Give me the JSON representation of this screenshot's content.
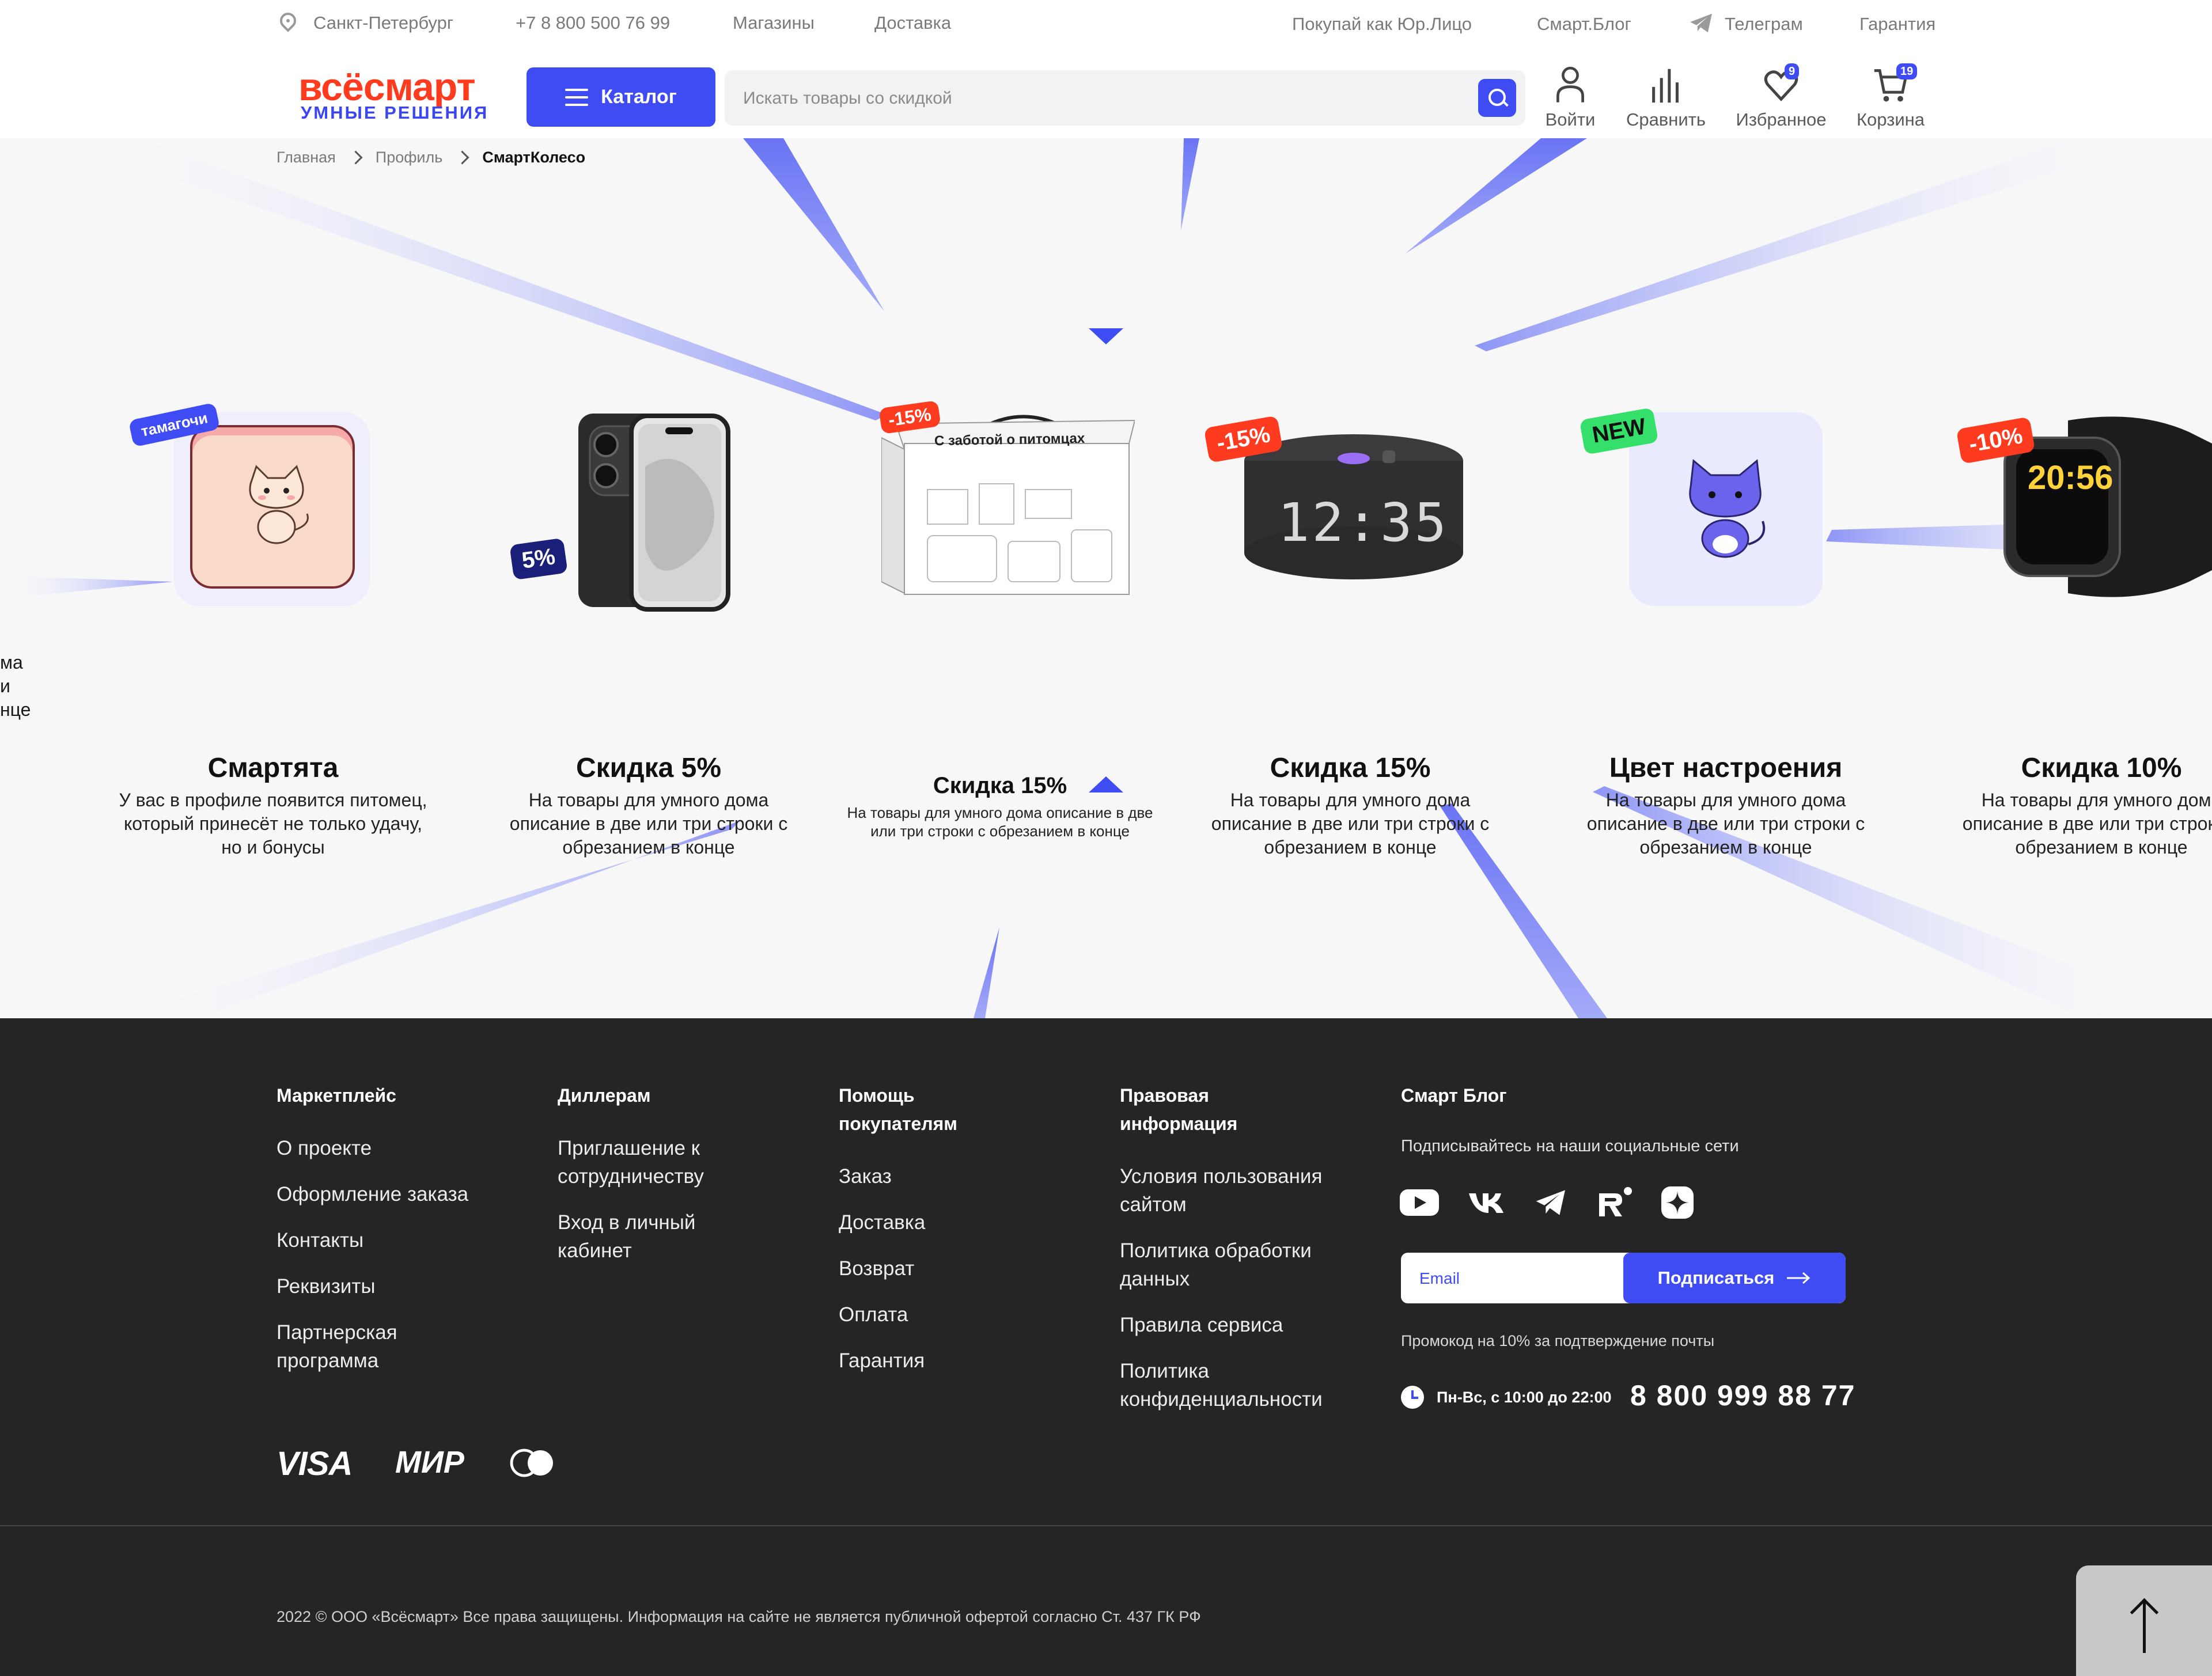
{
  "topbar": {
    "city": "Санкт-Петербург",
    "phone": "+7 8 800 500 76 99",
    "stores": "Магазины",
    "delivery": "Доставка",
    "legal_entity": "Покупай как Юр.Лицо",
    "blog": "Смарт.Блог",
    "telegram": "Телеграм",
    "warranty": "Гарантия"
  },
  "header": {
    "logo_top": "всёсмарт",
    "logo_bottom": "УМНЫЕ РЕШЕНИЯ",
    "catalog_label": "Каталог",
    "search_placeholder": "Искать товары со скидкой",
    "login_label": "Войти",
    "compare_label": "Сравнить",
    "favorites_label": "Избранное",
    "favorites_count": "9",
    "cart_label": "Корзина",
    "cart_count": "19"
  },
  "breadcrumb": {
    "items": [
      "Главная",
      "Профиль"
    ],
    "current": "СмартКолесо"
  },
  "wheel": {
    "left_partial": {
      "desc": [
        "ма",
        "и",
        "нце"
      ]
    },
    "cards": [
      {
        "tag": "тамагочи",
        "title": "Смартята",
        "desc": "У вас в профиле появится питомец, который принесёт не только удачу, но и бонусы"
      },
      {
        "tag": "5%",
        "title": "Скидка 5%",
        "desc": "На товары для умного дома описание в две или три строки с обрезанием в конце"
      },
      {
        "tag": "-15%",
        "title": "Скидка 15%",
        "desc": "На товары для умного дома описание в две или три строки с обрезанием в конце",
        "box_text": "С заботой о питомцах"
      },
      {
        "tag": "-15%",
        "title": "Скидка 15%",
        "desc": "На товары для умного дома описание в две или три строки с обрезанием в конце",
        "speaker_time": "12:35"
      },
      {
        "tag": "NEW",
        "title": "Цвет настроения",
        "desc": "На товары для умного дома описание в две или три строки с обрезанием в конце"
      },
      {
        "tag": "-10%",
        "title": "Скидка 10%",
        "desc": "На товары для умного дома описание в две или три строки с обрезанием в конце",
        "watch_time": "20:56"
      }
    ],
    "accent": "#3f4cf3"
  },
  "footer": {
    "col1": {
      "title": "Маркетплейс",
      "links": [
        "О проекте",
        "Оформление заказа",
        "Контакты",
        "Реквизиты",
        "Партнерская программа"
      ]
    },
    "col2": {
      "title": "Диллерам",
      "links": [
        "Приглашение к сотрудничеству",
        "Вход в личный кабинет"
      ]
    },
    "col3": {
      "title": "Помощь покупателям",
      "links": [
        "Заказ",
        "Доставка",
        "Возврат",
        "Оплата",
        "Гарантия"
      ]
    },
    "col4": {
      "title": "Правовая информация",
      "links": [
        "Условия пользования сайтом",
        "Политика обработки данных",
        "Правила сервиса",
        "Политика конфиденциальности"
      ]
    },
    "col5": {
      "title": "Смарт Блог"
    },
    "subscribe_text": "Подписывайтесь на наши социальные сети",
    "email_placeholder": "Email",
    "subscribe_button": "Подписаться",
    "promo_text": "Промокод на 10% за подтверждение почты",
    "hours": "Пн-Вс, с 10:00 до 22:00",
    "phone": "8 800 999 88 77",
    "payments": [
      "VISA",
      "МИР"
    ],
    "copyright": "2022 © ООО «Всёсмарт» Все права защищены. Информация на сайте не является публичной офертой согласно Ст. 437 ГК РФ"
  },
  "colors": {
    "accent": "#3f4cf3",
    "logo_red": "#ff3b1f",
    "footer_bg": "#252525",
    "tag_red": "#ff3b1f",
    "tag_green": "#35e06a",
    "tag_navy": "#1a1f7a"
  }
}
